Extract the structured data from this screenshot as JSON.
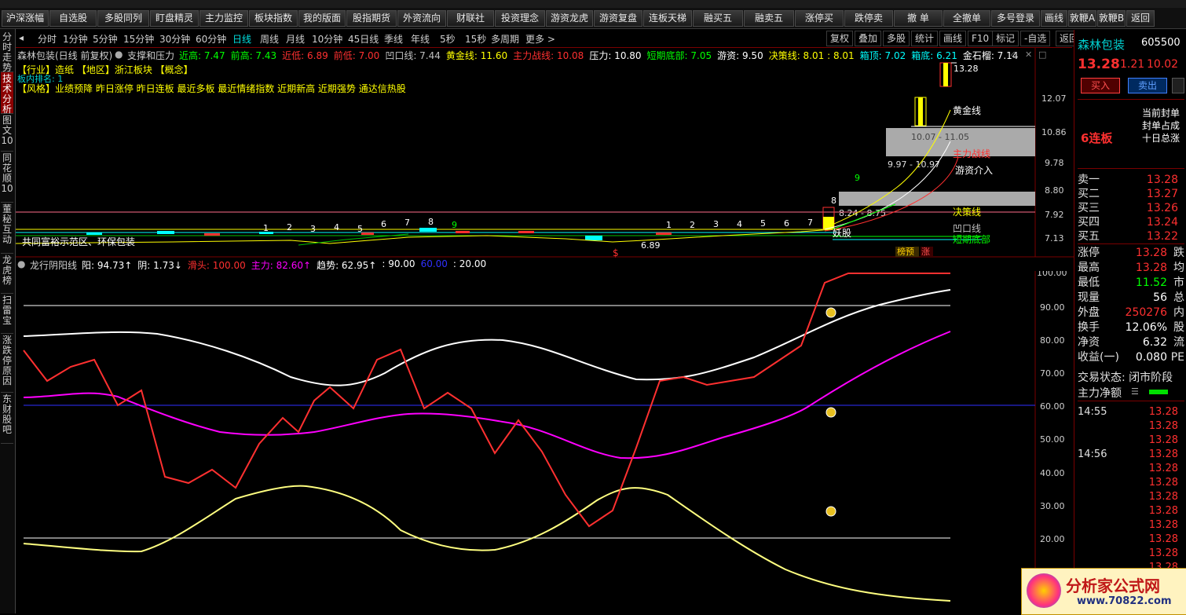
{
  "toolbar": {
    "buttons": [
      "沪深涨幅",
      "自选股",
      "多股同列",
      "盯盘精灵",
      "主力监控",
      "板块指数",
      "我的版面",
      "股指期货",
      "外资流向",
      "财联社",
      "投资理念",
      "游资龙虎",
      "游资复盘",
      "连板天梯",
      "融买五",
      "融卖五",
      "涨停买",
      "跌停卖",
      "撤 单",
      "全撤单",
      "多号登录",
      "画线",
      "敦鞭A",
      "敦鞭B",
      "返回"
    ]
  },
  "left_tabs": [
    "分时走势",
    "技术分析",
    "图文10",
    "同花顺10",
    "董秘互动",
    "龙虎榜",
    "扫雷宝",
    "涨跌停原因",
    "东财股吧"
  ],
  "period_bar": {
    "items": [
      "分时",
      "1分钟",
      "5分钟",
      "15分钟",
      "30分钟",
      "60分钟",
      "日线",
      "周线",
      "月线",
      "10分钟",
      "45日线",
      "季线",
      "年线",
      "5秒",
      "15秒",
      "多周期",
      "更多 >"
    ],
    "active": "日线",
    "right_items": [
      "复权",
      "叠加",
      "多股",
      "统计",
      "画线",
      "F10",
      "标记",
      "-自选",
      "返回"
    ]
  },
  "main_chart": {
    "header_stock": "森林包装(日线 前复权)",
    "header_indicator": "支撑和压力",
    "values": [
      {
        "label": "近高: 7.47",
        "color": "#00ff00"
      },
      {
        "label": "前高: 7.43",
        "color": "#00ff00"
      },
      {
        "label": "近低: 6.89",
        "color": "#ff3030"
      },
      {
        "label": "前低: 7.00",
        "color": "#ff3030"
      },
      {
        "label": "凹口线: 7.44",
        "color": "#c0c0c0"
      },
      {
        "label": "黄金线: 11.60",
        "color": "#ffff00"
      },
      {
        "label": "主力战线: 10.08",
        "color": "#ff3030"
      },
      {
        "label": "压力: 10.80",
        "color": "#ffffff"
      },
      {
        "label": "短期底部: 7.05",
        "color": "#00ff00"
      },
      {
        "label": "游资: 9.50",
        "color": "#ffffff"
      },
      {
        "label": "决策线: 8.01 : 8.01",
        "color": "#ffff00"
      },
      {
        "label": "箱顶: 7.02",
        "color": "#00ffff"
      },
      {
        "label": "箱底: 6.21",
        "color": "#00ffff"
      },
      {
        "label": "金石榴: 7.14",
        "color": "#ffffff"
      }
    ],
    "info_line1": "【行业】造纸 【地区】浙江板块 【概念】",
    "info_rank": "板内排名: 1",
    "info_line2": "【风格】业绩预降 昨日涨停 昨日连板 最近多板 最近情绪指数 近期新高 近期强势 通达信热股",
    "y_ticks": [
      "12.07",
      "10.86",
      "9.78",
      "8.80",
      "7.92",
      "7.13"
    ],
    "top_price": "13.28",
    "band_labels": [
      "10.07 - 11.05",
      "9.97 - 10.97",
      "8.24 - 8.75"
    ],
    "line_labels": [
      "黄金线",
      "主力战线",
      "游资介入",
      "决策线",
      "妖股",
      "凹口线",
      "短期底部"
    ],
    "low_label": "6.89",
    "note": "共同富裕示范区、环保包装",
    "seq_left": [
      "1",
      "2",
      "3",
      "4",
      "5",
      "6",
      "7",
      "8",
      "9"
    ],
    "seq_right": [
      "1",
      "2",
      "3",
      "4",
      "5",
      "6",
      "7",
      "8",
      "9"
    ],
    "badges": [
      "榜预",
      "涨"
    ],
    "dollar": "$"
  },
  "sub_chart": {
    "title": "龙行阴阳线",
    "values": [
      {
        "label": "阳: 94.73↑",
        "color": "#ffffff"
      },
      {
        "label": "阴: 1.73↓",
        "color": "#ffffff"
      },
      {
        "label": "滑头: 100.00",
        "color": "#ff3030"
      },
      {
        "label": "主力: 82.60↑",
        "color": "#ff00ff"
      },
      {
        "label": "趋势: 62.95↑",
        "color": "#ffffff"
      },
      {
        "label": ": 90.00",
        "color": "#ffffff"
      },
      {
        "label": "60.00",
        "color": "#3030ff"
      },
      {
        "label": ": 20.00",
        "color": "#ffffff"
      }
    ],
    "y_ticks": [
      "100.00",
      "90.00",
      "80.00",
      "70.00",
      "60.00",
      "50.00",
      "40.00",
      "30.00",
      "20.00"
    ]
  },
  "right_panel": {
    "stock_name": "森林包装",
    "stock_code": "605500",
    "price": "13.28",
    "change": "1.21",
    "change_pct": "10.02",
    "buy_btn": "买入",
    "sell_btn": "卖出",
    "streak": "6连板",
    "notes": [
      "当前封单",
      "封单占成",
      "十日总涨"
    ],
    "order_book": [
      {
        "k": "卖一",
        "v": "13.28"
      },
      {
        "k": "买二",
        "v": "13.27"
      },
      {
        "k": "买三",
        "v": "13.26"
      },
      {
        "k": "买四",
        "v": "13.24"
      },
      {
        "k": "买五",
        "v": "13.22"
      }
    ],
    "stats": [
      {
        "k": "涨停",
        "v": "13.28",
        "s": "跌",
        "vc": "#ff3030"
      },
      {
        "k": "最高",
        "v": "13.28",
        "s": "均",
        "vc": "#ff3030"
      },
      {
        "k": "最低",
        "v": "11.52",
        "s": "市",
        "vc": "#00ff00"
      },
      {
        "k": "现量",
        "v": "56",
        "s": "总",
        "vc": "#ffffff"
      },
      {
        "k": "外盘",
        "v": "250276",
        "s": "内",
        "vc": "#ff3030"
      },
      {
        "k": "换手",
        "v": "12.06%",
        "s": "股",
        "vc": "#ffffff"
      },
      {
        "k": "净资",
        "v": "6.32",
        "s": "流",
        "vc": "#ffffff"
      },
      {
        "k": "收益(一)",
        "v": "0.080",
        "s": "PE",
        "vc": "#ffffff"
      }
    ],
    "trade_status": "交易状态: 闭市阶段",
    "main_net": "主力净额",
    "ticks": [
      {
        "t": "14:55",
        "v": "13.28"
      },
      {
        "t": "",
        "v": "13.28"
      },
      {
        "t": "",
        "v": "13.28"
      },
      {
        "t": "14:56",
        "v": "13.28"
      },
      {
        "t": "",
        "v": "13.28"
      },
      {
        "t": "",
        "v": "13.28"
      },
      {
        "t": "",
        "v": "13.28"
      },
      {
        "t": "",
        "v": "13.28"
      },
      {
        "t": "",
        "v": "13.28"
      },
      {
        "t": "",
        "v": "13.28"
      },
      {
        "t": "",
        "v": "13.28"
      },
      {
        "t": "",
        "v": "13.28"
      },
      {
        "t": "",
        "v": "13.28"
      }
    ]
  },
  "watermark": {
    "brand": "分析家公式网",
    "url": "www.70822.com"
  }
}
